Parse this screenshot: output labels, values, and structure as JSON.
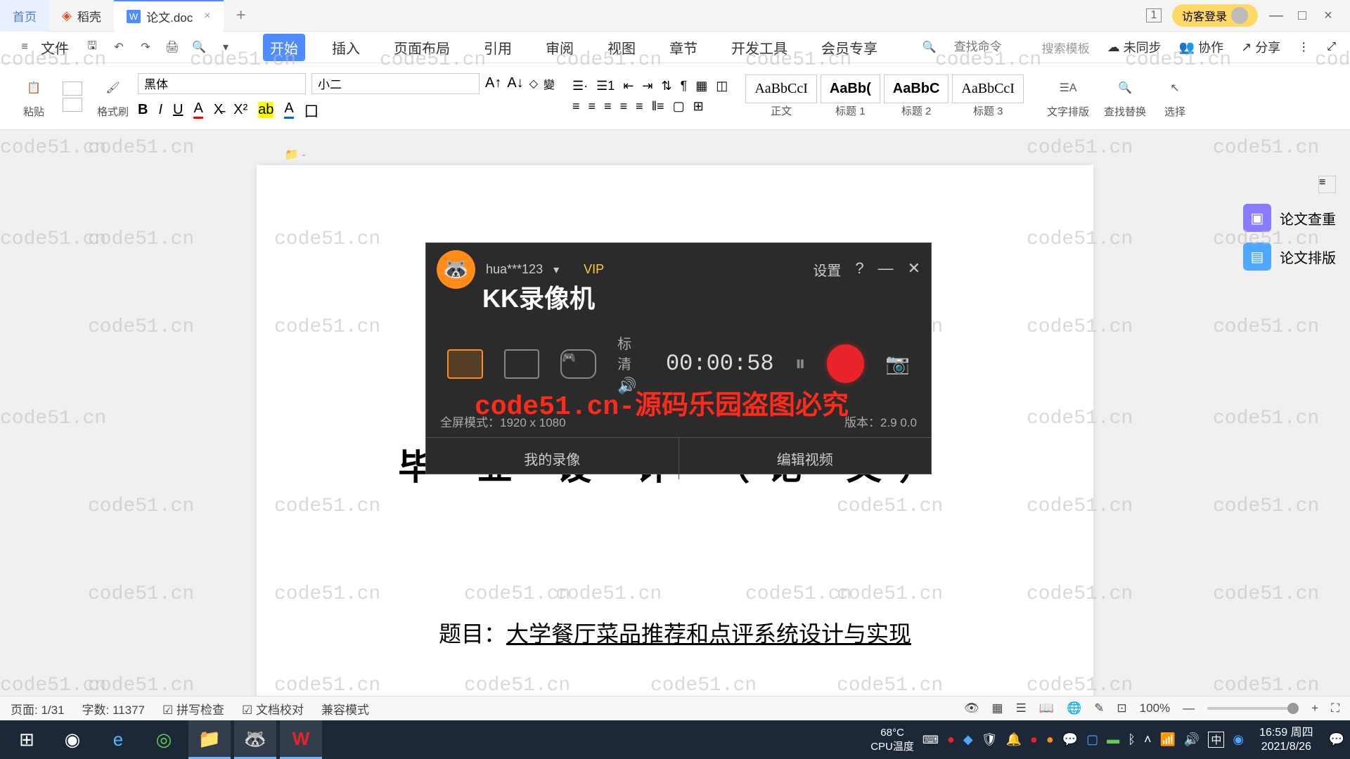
{
  "tabs": {
    "home": "首页",
    "shell": "稻壳",
    "doc": "论文.doc"
  },
  "titlebar": {
    "login": "访客登录",
    "count": "1"
  },
  "menu": {
    "file": "文件",
    "start": "开始",
    "insert": "插入",
    "layout": "页面布局",
    "ref": "引用",
    "review": "审阅",
    "view": "视图",
    "chapter": "章节",
    "devtools": "开发工具",
    "member": "会员专享",
    "search_cmd": "查找命令",
    "search_tpl": "搜索模板",
    "unsync": "未同步",
    "collab": "协作",
    "share": "分享"
  },
  "ribbon": {
    "paste": "粘贴",
    "format_painter": "格式刷",
    "font": "黑体",
    "size": "小二",
    "style_body": "正文",
    "style_h1": "标题 1",
    "style_h2": "标题 2",
    "style_h3": "标题 3",
    "text_layout": "文字排版",
    "find_replace": "查找替换",
    "select": "选择"
  },
  "sidebar": {
    "check": "论文查重",
    "layout": "论文排版"
  },
  "doc": {
    "title": "毕 业 设 计 （论 文）",
    "topic_label": "题目：",
    "topic_value": "大学餐厅菜品推荐和点评系统设计与实现"
  },
  "status": {
    "page": "页面: 1/31",
    "words": "字数: 11377",
    "spell": "拼写检查",
    "doccheck": "文档校对",
    "compat": "兼容模式",
    "zoom": "100%"
  },
  "recorder": {
    "title": "KK录像机",
    "user": "hua***123",
    "vip": "VIP",
    "settings": "设置",
    "quality": "标清",
    "time": "00:00:58",
    "mode": "全屏模式：1920 x 1080",
    "version": "版本：2.9 0.0",
    "my_rec": "我的录像",
    "edit": "编辑视频"
  },
  "overlay_text": "code51.cn-源码乐园盗图必究",
  "watermark": "code51.cn",
  "taskbar": {
    "temp": "68°C",
    "cpu": "CPU温度",
    "ime": "中",
    "time": "16:59",
    "day": "周四",
    "date": "2021/8/26"
  }
}
